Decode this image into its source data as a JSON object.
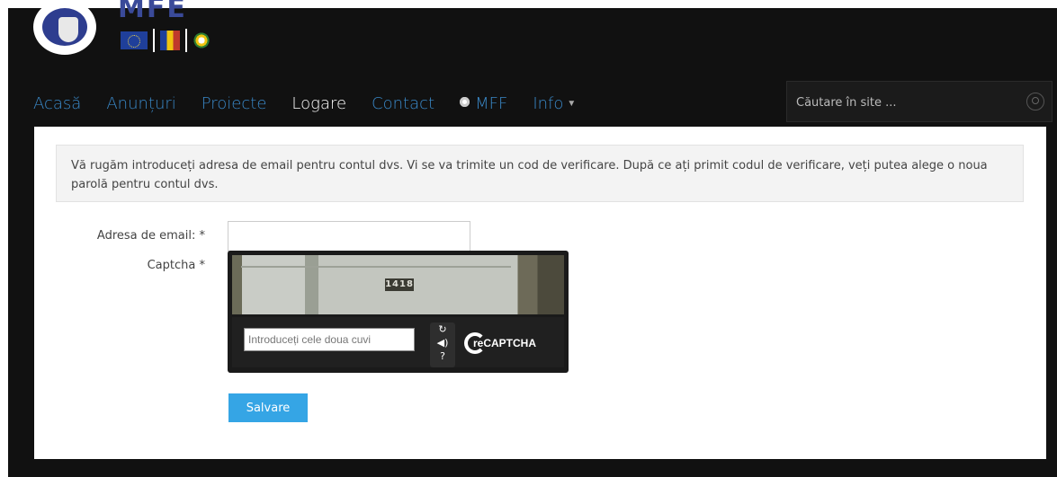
{
  "header": {
    "logo_text": "MFE",
    "icons": [
      "eu-flag-icon",
      "romania-flag-icon",
      "star-logo-icon"
    ]
  },
  "nav": {
    "items": [
      {
        "label": "Acasă",
        "active": false
      },
      {
        "label": "Anunțuri",
        "active": false
      },
      {
        "label": "Proiecte",
        "active": false
      },
      {
        "label": "Logare",
        "active": true
      },
      {
        "label": "Contact",
        "active": false
      },
      {
        "label": "MFF",
        "active": false
      },
      {
        "label": "Info",
        "active": false
      }
    ],
    "search_placeholder": "Căutare în site ..."
  },
  "main": {
    "info_text": "Vă rugăm introduceți adresa de email pentru contul dvs. Vi se va trimite un cod de verificare. După ce ați primit codul de verificare, veți putea alege o noua parolă pentru contul dvs.",
    "email_label": "Adresa de email: *",
    "email_value": "",
    "captcha_label": "Captcha *",
    "captcha": {
      "image_text": "1418",
      "input_placeholder": "Introduceți cele doua cuvi",
      "logo_text": "reCAPTCHA"
    },
    "save_label": "Salvare"
  },
  "colors": {
    "background": "#111111",
    "nav_link": "#3a89c9",
    "nav_active": "#ffffff",
    "button": "#35a5e5"
  }
}
